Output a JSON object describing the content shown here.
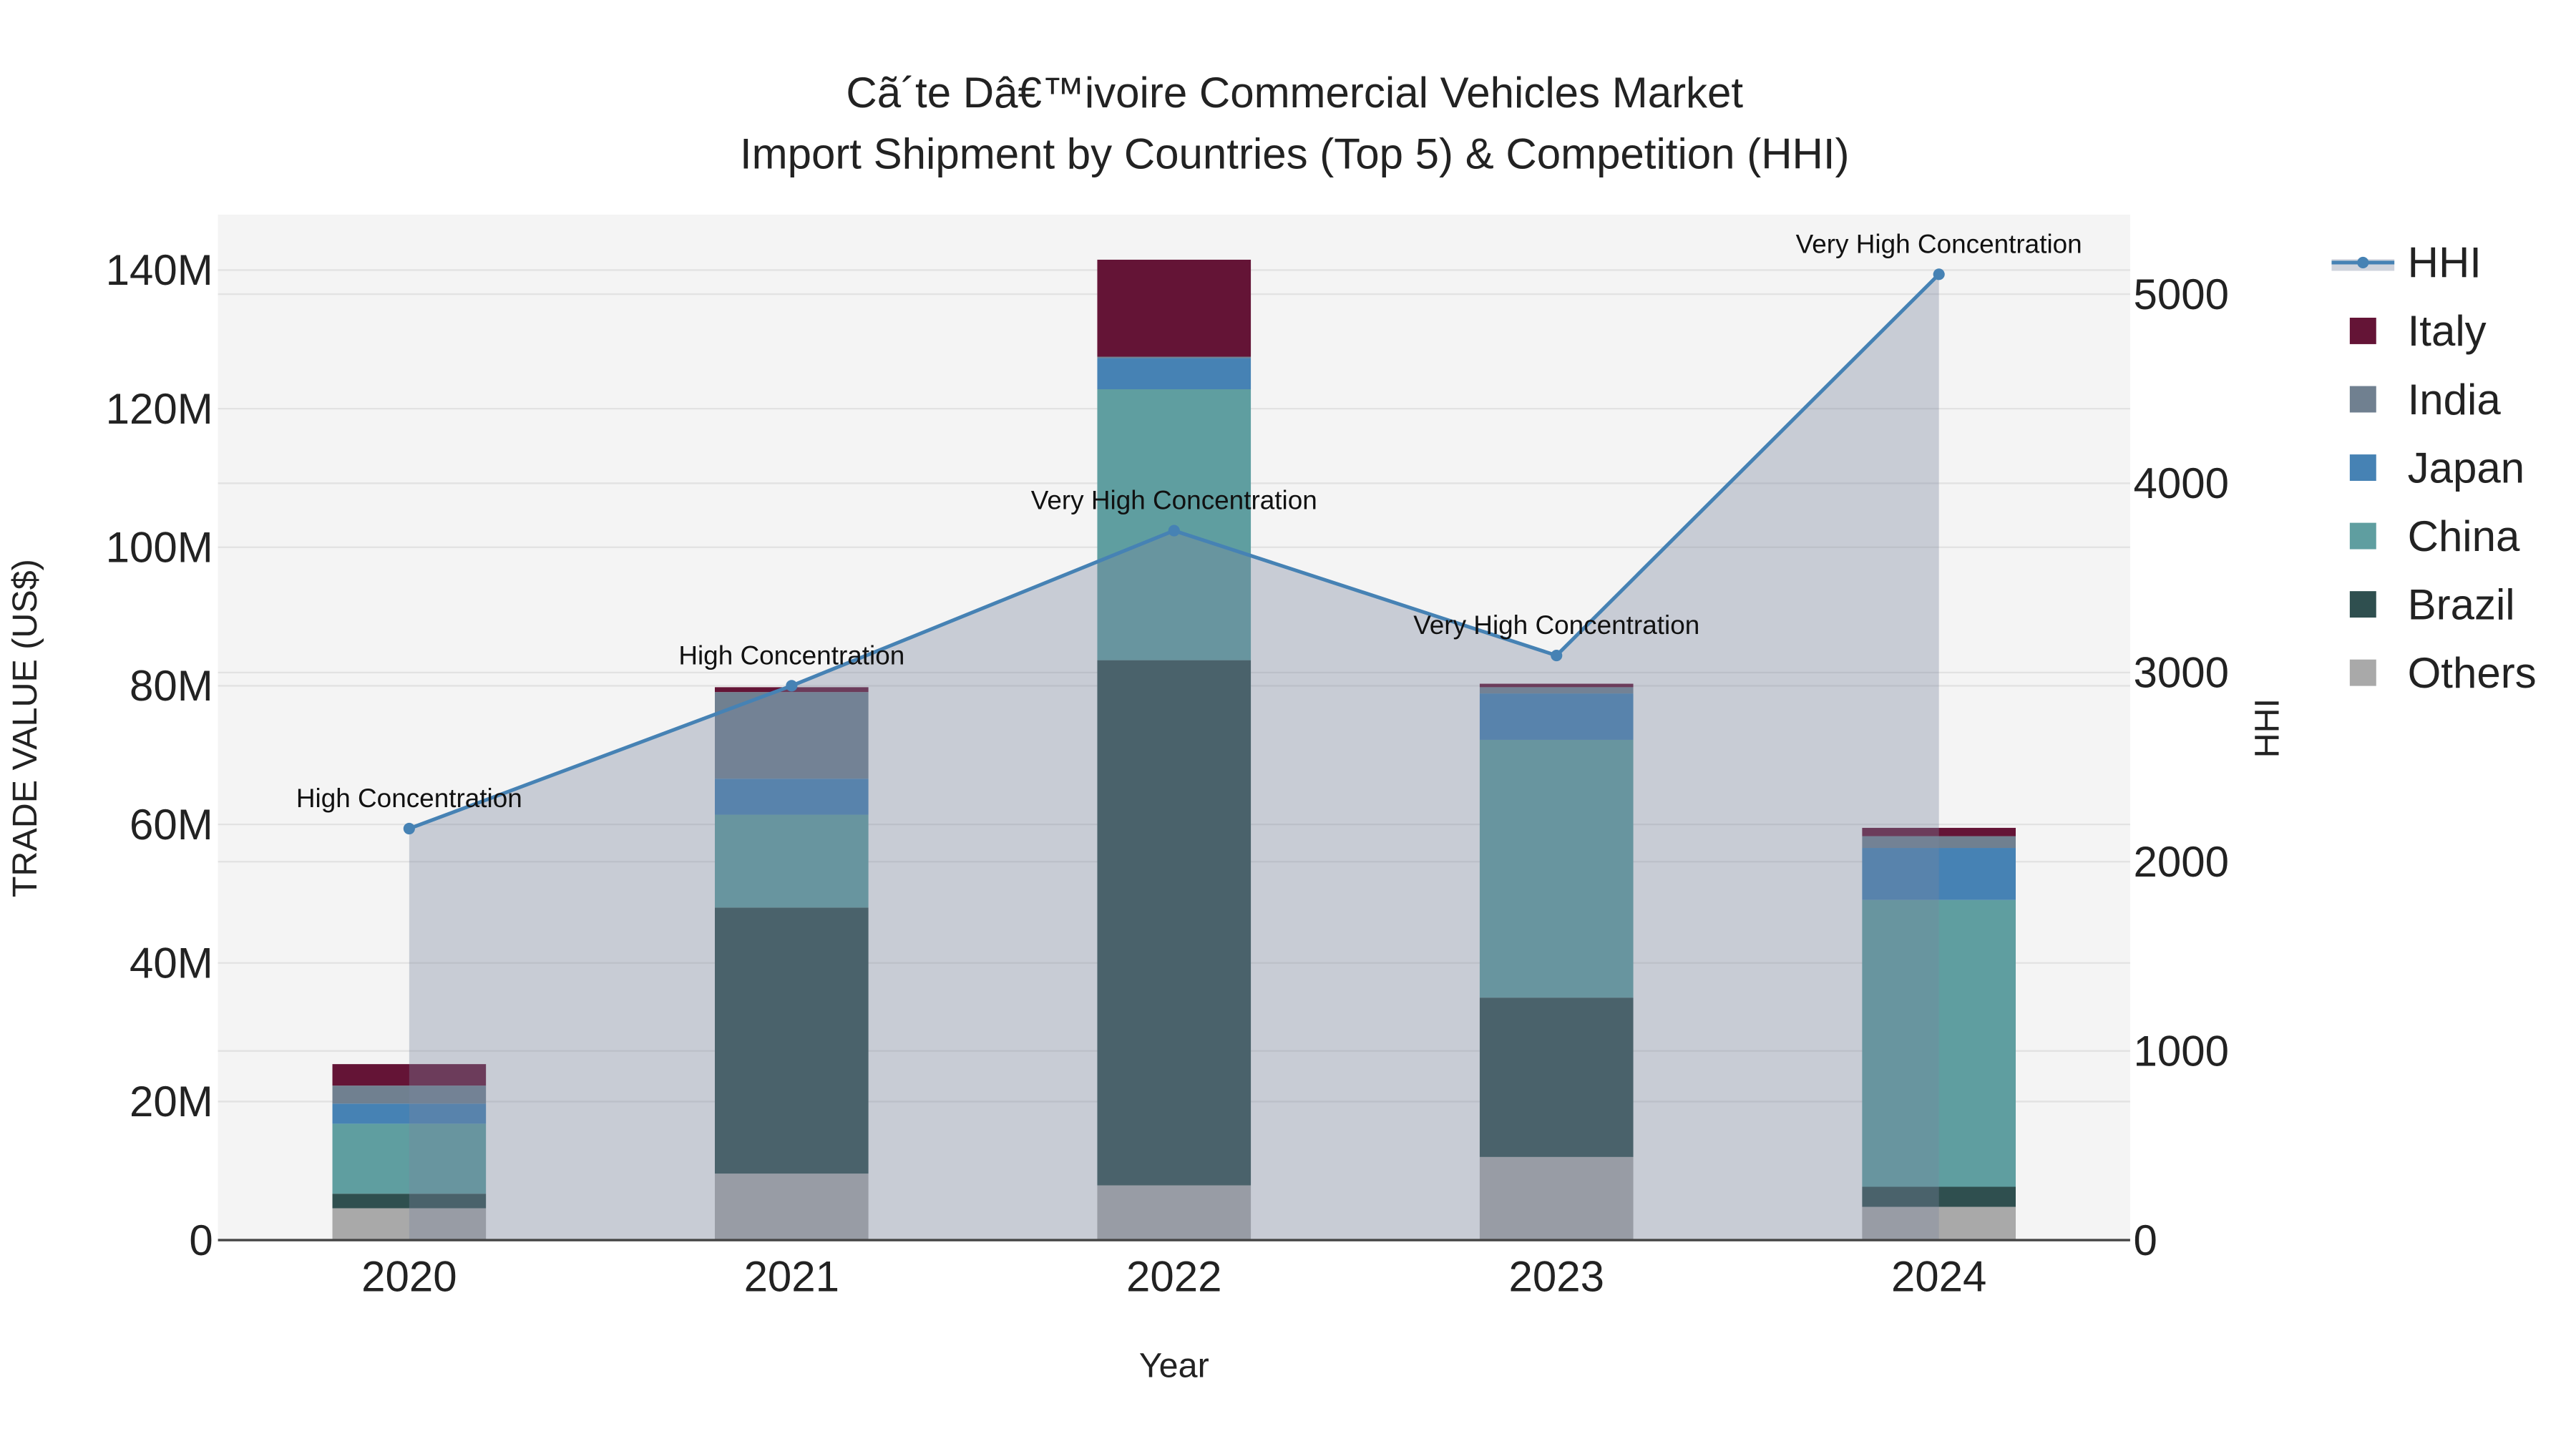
{
  "chart_data": {
    "type": "bar",
    "stacked": true,
    "title": "Cã´te Dâ€™ivoire Commercial Vehicles Market",
    "subtitle": "Import Shipment by Countries (Top 5) & Competition (HHI)",
    "xlabel": "Year",
    "ylabel": "TRADE VALUE (US$)",
    "y2label": "HHI",
    "categories": [
      "2020",
      "2021",
      "2022",
      "2023",
      "2024"
    ],
    "ylim": [
      0,
      148
    ],
    "y_unit": "M",
    "y_ticks": [
      0,
      20,
      40,
      60,
      80,
      100,
      120,
      140
    ],
    "y_tick_labels": [
      "0",
      "20M",
      "40M",
      "60M",
      "80M",
      "100M",
      "120M",
      "140M"
    ],
    "y2lim": [
      0,
      5420
    ],
    "y2_ticks": [
      0,
      1000,
      2000,
      3000,
      4000,
      5000
    ],
    "y2_tick_labels": [
      "0",
      "1000",
      "2000",
      "3000",
      "4000",
      "5000"
    ],
    "series": [
      {
        "name": "Others",
        "color": "#A9A9A9",
        "values": [
          4.6,
          9.6,
          7.9,
          12.0,
          4.8
        ]
      },
      {
        "name": "Brazil",
        "color": "#2F4F4F",
        "values": [
          2.1,
          38.4,
          75.8,
          23.0,
          2.9
        ]
      },
      {
        "name": "China",
        "color": "#5F9EA0",
        "values": [
          10.1,
          13.4,
          39.1,
          37.2,
          41.4
        ]
      },
      {
        "name": "Japan",
        "color": "#4682B4",
        "values": [
          2.9,
          5.2,
          4.5,
          6.7,
          7.5
        ]
      },
      {
        "name": "India",
        "color": "#708090",
        "values": [
          2.6,
          12.5,
          0.2,
          0.9,
          1.7
        ]
      },
      {
        "name": "Italy",
        "color": "#641436",
        "values": [
          3.1,
          0.7,
          14.0,
          0.5,
          1.2
        ]
      }
    ],
    "hhi": {
      "name": "HHI",
      "color": "#4682B4",
      "values": [
        2175,
        2930,
        3750,
        3090,
        5105
      ],
      "annotations": [
        "High Concentration",
        "High Concentration",
        "Very High Concentration",
        "Very High Concentration",
        "Very High Concentration"
      ]
    },
    "legend": {
      "placement": "right",
      "order": [
        "HHI",
        "Italy",
        "India",
        "Japan",
        "China",
        "Brazil",
        "Others"
      ]
    },
    "grid": true
  }
}
